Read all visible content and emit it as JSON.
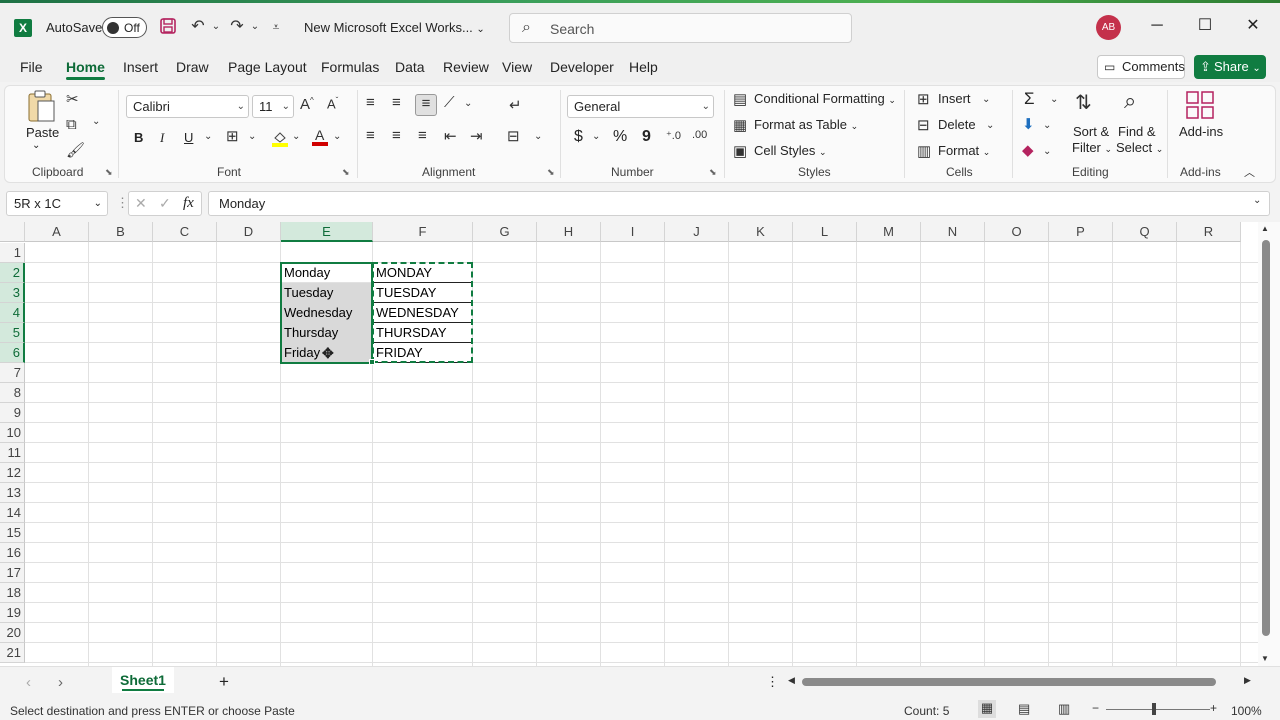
{
  "app": {
    "autosave_label": "AutoSave",
    "autosave_state": "Off",
    "doc_title": "New Microsoft Excel Works...",
    "search_placeholder": "Search",
    "avatar_initials": "AB",
    "accent_color": "#107c41"
  },
  "menu": {
    "tabs": [
      "File",
      "Home",
      "Insert",
      "Draw",
      "Page Layout",
      "Formulas",
      "Data",
      "Review",
      "View",
      "Developer",
      "Help"
    ],
    "active": "Home",
    "comments_label": "Comments",
    "share_label": "Share"
  },
  "ribbon": {
    "clipboard": {
      "paste": "Paste",
      "label": "Clipboard"
    },
    "font": {
      "name": "Calibri",
      "size": "11",
      "label": "Font",
      "bold": "B",
      "italic": "I",
      "underline": "U"
    },
    "alignment": {
      "label": "Alignment"
    },
    "number": {
      "format": "General",
      "label": "Number",
      "currency": "$",
      "percent": "%",
      "comma": "9"
    },
    "styles": {
      "conditional": "Conditional Formatting",
      "table": "Format as Table",
      "cell": "Cell Styles",
      "label": "Styles"
    },
    "cells": {
      "insert": "Insert",
      "delete": "Delete",
      "format": "Format",
      "label": "Cells"
    },
    "editing": {
      "sort1": "Sort &",
      "sort2": "Filter",
      "find1": "Find &",
      "find2": "Select",
      "label": "Editing",
      "sum": "Σ"
    },
    "addins": {
      "button": "Add-ins",
      "label": "Add-ins"
    }
  },
  "formula_bar": {
    "name_box": "5R x 1C",
    "fx": "fx",
    "content": "Monday"
  },
  "grid": {
    "columns": [
      "A",
      "B",
      "C",
      "D",
      "E",
      "F",
      "G",
      "H",
      "I",
      "J",
      "K",
      "L",
      "M",
      "N",
      "O",
      "P",
      "Q",
      "R"
    ],
    "rows": [
      "1",
      "2",
      "3",
      "4",
      "5",
      "6",
      "7",
      "8",
      "9",
      "10",
      "11",
      "12",
      "13",
      "14",
      "15",
      "16",
      "17",
      "18",
      "19",
      "20",
      "21"
    ],
    "col_e": [
      "Monday",
      "Tuesday",
      "Wednesday",
      "Thursday",
      "Friday"
    ],
    "col_f": [
      "MONDAY",
      "TUESDAY",
      "WEDNESDAY",
      "THURSDAY",
      "FRIDAY"
    ]
  },
  "sheets": {
    "active": "Sheet1",
    "add": "+"
  },
  "status": {
    "message": "Select destination and press ENTER or choose Paste",
    "count": "Count: 5",
    "zoom": "100%"
  }
}
